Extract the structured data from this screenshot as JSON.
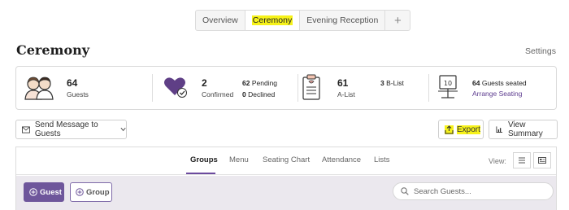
{
  "top_tabs": [
    {
      "label": "Overview"
    },
    {
      "label": "Ceremony"
    },
    {
      "label": "Evening Reception"
    },
    {
      "label": "+"
    }
  ],
  "page": {
    "title": "Ceremony",
    "settings_label": "Settings"
  },
  "stats": {
    "guests": {
      "count": "64",
      "label": "Guests"
    },
    "confirmed": {
      "count": "2",
      "label": "Confirmed",
      "pending_count": "62",
      "pending_label": "Pending",
      "declined_count": "0",
      "declined_label": "Declined"
    },
    "alist": {
      "count": "61",
      "label": "A-List",
      "blist_count": "3",
      "blist_label": "B-List"
    },
    "seating": {
      "seated_count": "64",
      "seated_label": "Guests seated",
      "arrange_label": "Arrange Seating"
    }
  },
  "actions": {
    "message_label": "Send Message to Guests",
    "export_label": "Export",
    "summary_label": "View Summary"
  },
  "sub_tabs": [
    {
      "label": "Groups"
    },
    {
      "label": "Menu"
    },
    {
      "label": "Seating Chart"
    },
    {
      "label": "Attendance"
    },
    {
      "label": "Lists"
    }
  ],
  "view": {
    "label": "View:"
  },
  "toolbar": {
    "guest_label": "Guest",
    "group_label": "Group",
    "search_placeholder": "Search Guests..."
  },
  "colors": {
    "accent": "#6e569b",
    "highlight": "#f6f21a"
  }
}
